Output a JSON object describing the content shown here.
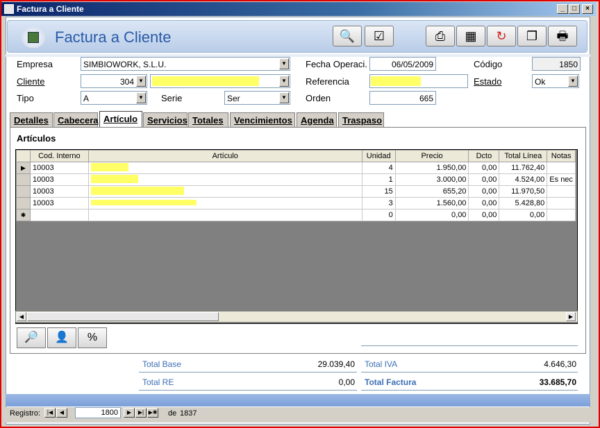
{
  "window": {
    "title": "Factura a Cliente"
  },
  "header": {
    "title": "Factura a Cliente"
  },
  "form": {
    "empresa_label": "Empresa",
    "empresa_value": "SIMBIOWORK, S.L.U.",
    "fecha_label": "Fecha Operaci.",
    "fecha_value": "06/05/2009",
    "codigo_label": "Código",
    "codigo_value": "1850",
    "cliente_label": "Cliente",
    "cliente_value": "304",
    "referencia_label": "Referencia",
    "estado_label": "Estado",
    "estado_value": "Ok",
    "tipo_label": "Tipo",
    "tipo_value": "A",
    "serie_label": "Serie",
    "serie_value": "Ser",
    "orden_label": "Orden",
    "orden_value": "665"
  },
  "tabs": [
    "Detalles",
    "Cabecera",
    "Artículo",
    "Servicios",
    "Totales",
    "Vencimientos",
    "Agenda",
    "Traspaso"
  ],
  "section_title": "Artículos",
  "grid": {
    "columns": [
      "Cod. Interno",
      "Artículo",
      "Unidad",
      "Precio",
      "Dcto",
      "Total Línea",
      "Notas"
    ],
    "rows": [
      {
        "cod": "10003",
        "unidad": "4",
        "precio": "1.950,00",
        "dcto": "0,00",
        "total": "11.762,40",
        "notas": ""
      },
      {
        "cod": "10003",
        "unidad": "1",
        "precio": "3.000,00",
        "dcto": "0,00",
        "total": "4.524,00",
        "notas": "Es nec"
      },
      {
        "cod": "10003",
        "unidad": "15",
        "precio": "655,20",
        "dcto": "0,00",
        "total": "11.970,50",
        "notas": ""
      },
      {
        "cod": "10003",
        "unidad": "3",
        "precio": "1.560,00",
        "dcto": "0,00",
        "total": "5.428,80",
        "notas": ""
      }
    ],
    "new_row": {
      "unidad": "0",
      "precio": "0,00",
      "dcto": "0,00",
      "total": "0,00"
    }
  },
  "totals": {
    "base_label": "Total Base",
    "base_value": "29.039,40",
    "iva_label": "Total IVA",
    "iva_value": "4.646,30",
    "re_label": "Total RE",
    "re_value": "0,00",
    "factura_label": "Total Factura",
    "factura_value": "33.685,70"
  },
  "navigator": {
    "label": "Registro:",
    "current": "1800",
    "of_label": "de",
    "total": "1837"
  }
}
